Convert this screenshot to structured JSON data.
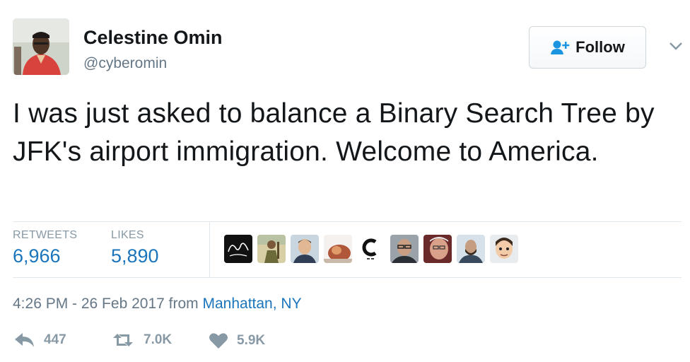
{
  "user": {
    "name": "Celestine Omin",
    "handle": "@cyberomin",
    "avatar_icon": "profile-photo"
  },
  "follow": {
    "label": "Follow",
    "icon": "add-user-icon"
  },
  "menu": {
    "icon": "chevron-down-icon"
  },
  "tweet": {
    "text": "I was just asked to balance a Binary Search Tree by JFK's airport immigration. Welcome to America."
  },
  "stats": {
    "retweets_label": "RETWEETS",
    "retweets_value": "6,966",
    "likes_label": "LIKES",
    "likes_value": "5,890"
  },
  "likers": [
    {
      "icon": "avatar-script-logo"
    },
    {
      "icon": "avatar-figure"
    },
    {
      "icon": "avatar-man-smiling"
    },
    {
      "icon": "avatar-blurred"
    },
    {
      "icon": "avatar-c-logo"
    },
    {
      "icon": "avatar-man-glasses"
    },
    {
      "icon": "avatar-older-man"
    },
    {
      "icon": "avatar-man-beard"
    },
    {
      "icon": "avatar-cartoon"
    }
  ],
  "meta": {
    "time": "4:26 PM - 26 Feb 2017",
    "from": "from",
    "location": "Manhattan, NY"
  },
  "actions": {
    "reply_count": "447",
    "retweet_count": "7.0K",
    "like_count": "5.9K"
  },
  "colors": {
    "link": "#1b75bb",
    "muted": "#657786",
    "action": "#8899a6",
    "border": "#e1e8ed"
  }
}
